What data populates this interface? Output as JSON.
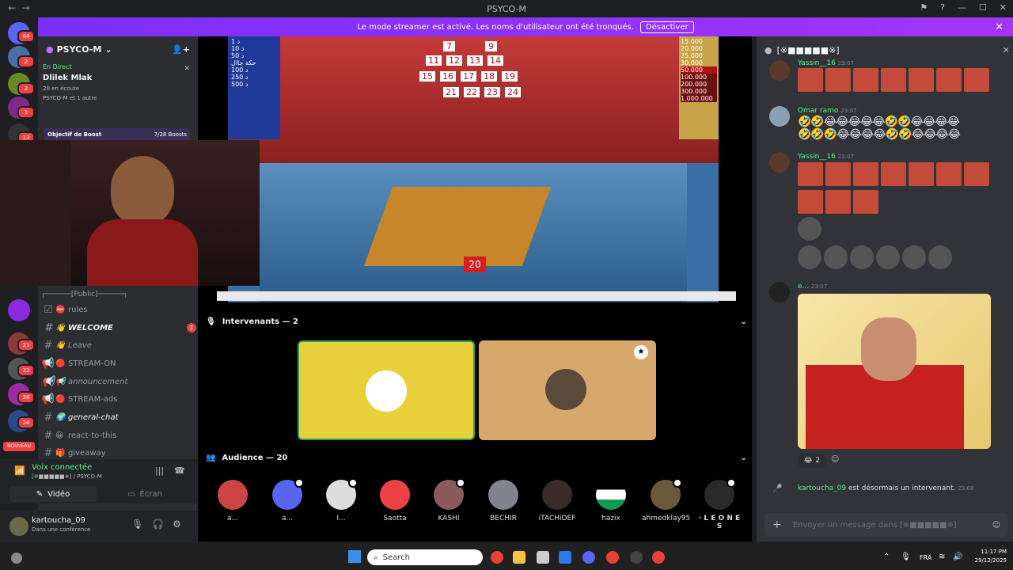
{
  "window": {
    "title": "PSYCO-M",
    "min": "—",
    "max": "☐",
    "close": "✕"
  },
  "banner": {
    "text": "Le mode streamer est activé. Les noms d'utilisateur ont été tronqués.",
    "button": "Désactiver"
  },
  "guilds": [
    {
      "badge": "64"
    },
    {
      "badge": "2"
    },
    {
      "badge": "2"
    },
    {
      "badge": "1"
    },
    {
      "badge": "13"
    }
  ],
  "server": {
    "name": "PSYCO-M",
    "live_label": "En Direct",
    "live_title": "Dlilek Mlak",
    "live_listeners": "20 en écoute",
    "live_host": "PSYCO-M et 1 autre",
    "boost_label": "Objectif de Boost",
    "boost_count": "7/28 Boosts"
  },
  "channels": [
    {
      "name": "┌──────[Public]──────┐",
      "icon": ""
    },
    {
      "name": "rules",
      "icon": "⛔"
    },
    {
      "name": "WELCOME",
      "icon": "👋",
      "badge": "1"
    },
    {
      "name": "Leave",
      "icon": "👋"
    },
    {
      "name": "STREAM-ON",
      "icon": "🔴"
    },
    {
      "name": "announcement",
      "icon": "📢"
    },
    {
      "name": "STREAM-ads",
      "icon": "🔴"
    },
    {
      "name": "general-chat",
      "icon": "🌍"
    },
    {
      "name": "react-to-this",
      "icon": "😀"
    },
    {
      "name": "giveaway",
      "icon": "🎁"
    }
  ],
  "guild_badges_lower": [
    "21",
    "22",
    "28",
    "24"
  ],
  "guild_new_label": "NOUVEAU",
  "voice": {
    "status": "Voix connectée",
    "location": "[※■■■■■※] / PSYCO-M",
    "video": "Vidéo",
    "screen": "Écran"
  },
  "user": {
    "name": "kartoucha_09",
    "status": "Dans une conférence"
  },
  "stage": {
    "numbers_top": [
      "7",
      "9"
    ],
    "numbers_row2": [
      "11",
      "12",
      "13",
      "14"
    ],
    "numbers_row3": [
      "15",
      "16",
      "17",
      "18",
      "19"
    ],
    "numbers_row4": [
      "21",
      "22",
      "23",
      "24"
    ],
    "left_board": [
      "1 د",
      "10 د",
      "50 د",
      "حكة جاال",
      "100 د",
      "250 د",
      "500 د"
    ],
    "right_board": [
      "15.000",
      "20.000",
      "25.000",
      "30.000",
      "50.000",
      "100.000",
      "200.000",
      "300.000",
      "1.000.000"
    ],
    "box_number": "20"
  },
  "speakers_header": "Intervenants — 2",
  "audience_header": "Audience — 20",
  "audience": [
    "a...",
    "a...",
    "I...",
    "Saotta",
    "KASHI",
    "BECHIR",
    "iTACHiDEF",
    "hazix",
    "ahmedklay95",
    "· L E O N E S"
  ],
  "chat": {
    "channel": "[※■■■■■※]",
    "messages": [
      {
        "author": "Yassin__16",
        "time": "23:07"
      },
      {
        "author": "Omar ramo",
        "time": "23:07"
      },
      {
        "author": "Yassin__16",
        "time": "23:07"
      },
      {
        "author": "e...",
        "time": "23:07"
      }
    ],
    "reaction": "2",
    "system_user": "kartoucha_09",
    "system_text": "est désormais un intervenant.",
    "system_time": "23:08",
    "input_placeholder": "Envoyer un message dans [※■■■■■※]"
  },
  "taskbar": {
    "search": "Search",
    "lang": "FRA",
    "time": "11:17 PM",
    "date": "29/12/2025"
  },
  "colors": {
    "banner": "#8a2be2",
    "speaker1": "#e8d03a",
    "speaker2": "#d6a86c",
    "live": "#57f287"
  }
}
